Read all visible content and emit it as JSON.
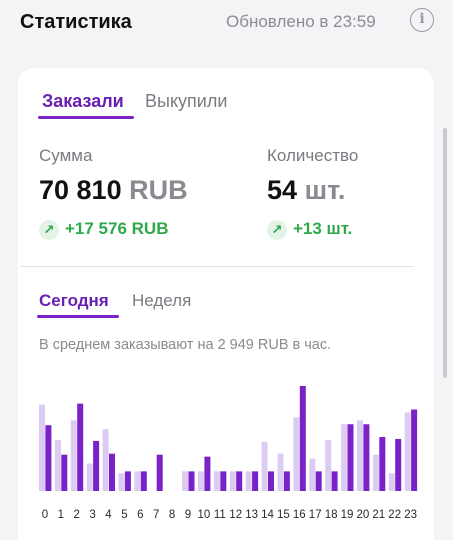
{
  "header": {
    "title": "Статистика",
    "updated": "Обновлено в 23:59"
  },
  "tabs": {
    "ordered": "Заказали",
    "bought": "Выкупили"
  },
  "metrics": {
    "sum": {
      "label": "Сумма",
      "value": "70 810",
      "unit": "RUB",
      "delta": "+17 576 RUB"
    },
    "qty": {
      "label": "Количество",
      "value": "54",
      "unit": "шт.",
      "delta": "+13 шт."
    }
  },
  "period_tabs": {
    "today": "Сегодня",
    "week": "Неделя"
  },
  "average_text": "В среднем заказывают на 2 949 RUB в час.",
  "colors": {
    "accent": "#7a22c8",
    "accent_light": "#dccbf2",
    "positive": "#2fa84a"
  },
  "chart_data": {
    "type": "bar",
    "categories": [
      "0",
      "1",
      "2",
      "3",
      "4",
      "5",
      "6",
      "7",
      "8",
      "9",
      "10",
      "11",
      "12",
      "13",
      "14",
      "15",
      "16",
      "17",
      "18",
      "19",
      "20",
      "21",
      "22",
      "23"
    ],
    "series": [
      {
        "values": [
          88,
          52,
          72,
          28,
          63,
          18,
          20,
          0,
          0,
          20,
          20,
          20,
          20,
          20,
          50,
          38,
          75,
          33,
          52,
          68,
          72,
          37,
          18,
          80
        ]
      },
      {
        "values": [
          67,
          37,
          89,
          51,
          38,
          20,
          20,
          37,
          0,
          20,
          35,
          20,
          20,
          20,
          20,
          20,
          107,
          20,
          20,
          68,
          68,
          55,
          53,
          83
        ]
      }
    ],
    "ylim": [
      0,
      110
    ]
  }
}
